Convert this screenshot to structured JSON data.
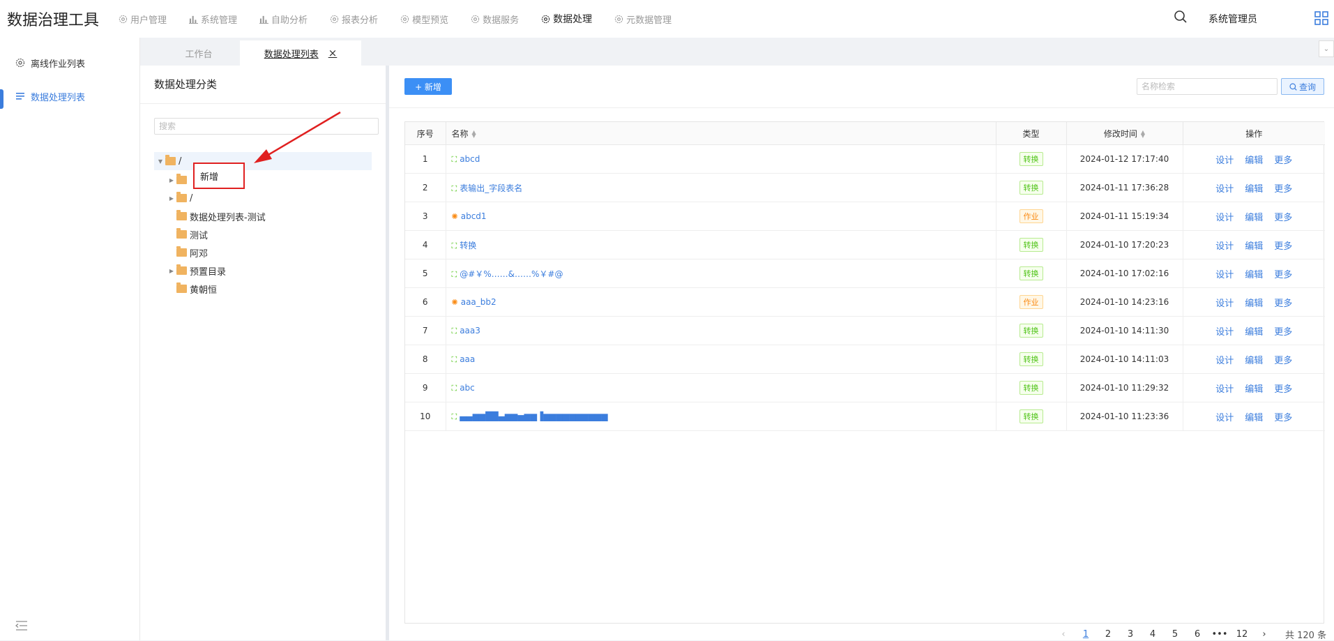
{
  "app": {
    "title": "数据治理工具"
  },
  "nav": {
    "items": [
      {
        "label": "用户管理",
        "icon": "gear-icon"
      },
      {
        "label": "系统管理",
        "icon": "bar-chart-icon"
      },
      {
        "label": "自助分析",
        "icon": "bar-chart-icon"
      },
      {
        "label": "报表分析",
        "icon": "gear-icon"
      },
      {
        "label": "模型预览",
        "icon": "gear-icon"
      },
      {
        "label": "数据服务",
        "icon": "gear-icon"
      },
      {
        "label": "数据处理",
        "icon": "gear-icon",
        "active": true
      },
      {
        "label": "元数据管理",
        "icon": "gear-icon"
      }
    ]
  },
  "user": {
    "name": "系统管理员"
  },
  "sidebar": {
    "items": [
      {
        "label": "离线作业列表",
        "icon": "gear-icon"
      },
      {
        "label": "数据处理列表",
        "icon": "list-icon",
        "active": true
      }
    ]
  },
  "tabs": [
    {
      "label": "工作台"
    },
    {
      "label": "数据处理列表",
      "active": true,
      "close": "×"
    }
  ],
  "left_panel": {
    "title": "数据处理分类",
    "search_placeholder": "搜索",
    "tree": [
      {
        "label": "/",
        "depth": 0,
        "expanded": true,
        "selected": true
      },
      {
        "label": "",
        "depth": 1,
        "has_children": true
      },
      {
        "label": "/",
        "depth": 1,
        "has_children": true
      },
      {
        "label": "数据处理列表-测试",
        "depth": 1
      },
      {
        "label": "测试",
        "depth": 1
      },
      {
        "label": "阿邓",
        "depth": 1
      },
      {
        "label": "预置目录",
        "depth": 1,
        "has_children": true
      },
      {
        "label": "黄朝恒",
        "depth": 1
      }
    ],
    "context_menu": {
      "label": "新增"
    }
  },
  "right_panel": {
    "add_label": "+ 新增",
    "search_placeholder": "名称检索",
    "query_label": "查询",
    "columns": [
      "序号",
      "名称",
      "类型",
      "修改时间",
      "操作"
    ],
    "ops": [
      "设计",
      "编辑",
      "更多"
    ],
    "rows": [
      {
        "no": "1",
        "name": "abcd",
        "type": "转换",
        "kind": "transform",
        "time": "2024-01-12 17:17:40"
      },
      {
        "no": "2",
        "name": "表输出_字段表名",
        "type": "转换",
        "kind": "transform",
        "time": "2024-01-11 17:36:28"
      },
      {
        "no": "3",
        "name": "abcd1",
        "type": "作业",
        "kind": "job",
        "time": "2024-01-11 15:19:34"
      },
      {
        "no": "4",
        "name": "转换",
        "type": "转换",
        "kind": "transform",
        "time": "2024-01-10 17:20:23"
      },
      {
        "no": "5",
        "name": "@#￥%……&……%￥#@",
        "type": "转换",
        "kind": "transform",
        "time": "2024-01-10 17:02:16"
      },
      {
        "no": "6",
        "name": "aaa_bb2",
        "type": "作业",
        "kind": "job",
        "time": "2024-01-10 14:23:16"
      },
      {
        "no": "7",
        "name": "aaa3",
        "type": "转换",
        "kind": "transform",
        "time": "2024-01-10 14:11:30"
      },
      {
        "no": "8",
        "name": "aaa",
        "type": "转换",
        "kind": "transform",
        "time": "2024-01-10 14:11:03"
      },
      {
        "no": "9",
        "name": "abc",
        "type": "转换",
        "kind": "transform",
        "time": "2024-01-10 11:29:32"
      },
      {
        "no": "10",
        "name": "▄▄▆▆██▄▆▆▅▆▆▐▆▆▆▆▆▆▆▆▆▆",
        "type": "转换",
        "kind": "transform",
        "time": "2024-01-10 11:23:36"
      }
    ]
  },
  "pagination": {
    "prev": "‹",
    "pages": [
      "1",
      "2",
      "3",
      "4",
      "5",
      "6",
      "•••",
      "12"
    ],
    "active_page": "1",
    "next": "›",
    "total": "共 120 条"
  },
  "colors": {
    "accent": "#3b7ddd",
    "primary_button": "#3c8ff5",
    "folder": "#f0b360",
    "badge_transform": "#52c41a",
    "badge_job": "#fa8c16",
    "annotation_red": "#e02020"
  }
}
